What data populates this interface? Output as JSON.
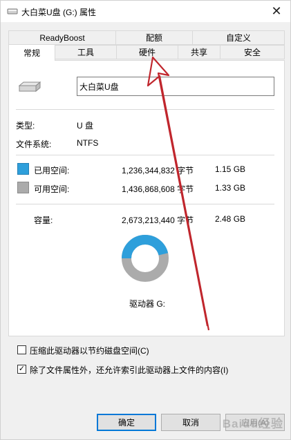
{
  "window": {
    "title": "大白菜U盘 (G:) 属性",
    "close": "✕"
  },
  "tabs": {
    "row1": [
      "ReadyBoost",
      "配额",
      "自定义"
    ],
    "row2": [
      "常规",
      "工具",
      "硬件",
      "共享",
      "安全"
    ],
    "active": "常规"
  },
  "general": {
    "volume_name": "大白菜U盘",
    "type_label": "类型:",
    "type_value": "U 盘",
    "fs_label": "文件系统:",
    "fs_value": "NTFS",
    "used_label": "已用空间:",
    "used_bytes": "1,236,344,832 字节",
    "used_size": "1.15 GB",
    "free_label": "可用空间:",
    "free_bytes": "1,436,868,608 字节",
    "free_size": "1.33 GB",
    "cap_label": "容量:",
    "cap_bytes": "2,673,213,440 字节",
    "cap_size": "2.48 GB",
    "drive_label": "驱动器 G:",
    "used_color": "#2e9fdb",
    "free_color": "#ababab",
    "used_fraction": 0.4625
  },
  "options": {
    "compress_label": "压缩此驱动器以节约磁盘空间(C)",
    "compress_checked": false,
    "index_label": "除了文件属性外，还允许索引此驱动器上文件的内容(I)",
    "index_checked": true,
    "check_mark": "✓"
  },
  "buttons": {
    "ok": "确定",
    "cancel": "取消",
    "apply": "应用(A)"
  },
  "watermark": "Baidu经验",
  "annotation_color": "#c0262d"
}
